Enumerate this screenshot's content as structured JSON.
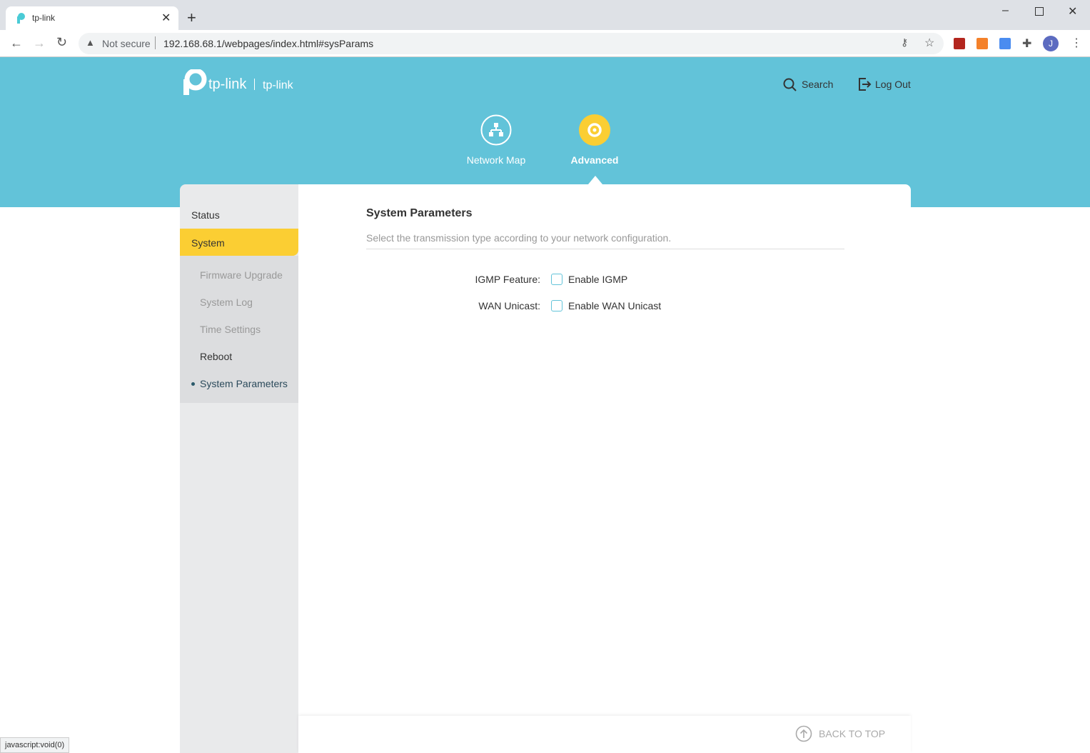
{
  "browser": {
    "tab_title": "tp-link",
    "security": "Not secure",
    "url": "192.168.68.1/webpages/index.html#sysParams",
    "profile_initial": "J",
    "status_bar": "javascript:void(0)"
  },
  "header": {
    "brand": "tp-link",
    "model": "tp-link",
    "search": "Search",
    "logout": "Log Out",
    "nav": [
      {
        "label": "Network Map"
      },
      {
        "label": "Advanced"
      }
    ]
  },
  "sidebar": {
    "items": [
      {
        "label": "Status"
      },
      {
        "label": "System"
      }
    ],
    "sub": [
      {
        "label": "Firmware Upgrade"
      },
      {
        "label": "System Log"
      },
      {
        "label": "Time Settings"
      },
      {
        "label": "Reboot"
      },
      {
        "label": "System Parameters"
      }
    ]
  },
  "main": {
    "title": "System Parameters",
    "description": "Select the transmission type according to your network configuration.",
    "fields": [
      {
        "label": "IGMP Feature:",
        "option": "Enable IGMP",
        "checked": false
      },
      {
        "label": "WAN Unicast:",
        "option": "Enable WAN Unicast",
        "checked": false
      }
    ]
  },
  "footer": {
    "back_to_top": "BACK TO TOP"
  },
  "colors": {
    "header": "#62c3d9",
    "accent": "#fbce33"
  }
}
